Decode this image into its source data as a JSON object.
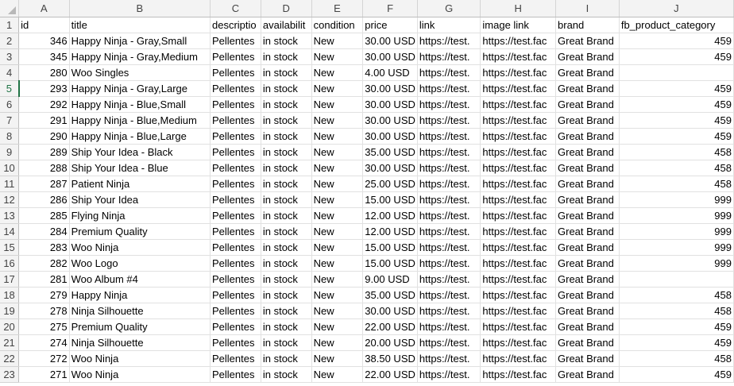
{
  "columns": [
    "A",
    "B",
    "C",
    "D",
    "E",
    "F",
    "G",
    "H",
    "I",
    "J"
  ],
  "rows": [
    {
      "n": "1",
      "cells": [
        "id",
        "title",
        "descriptio",
        "availabilit",
        "condition",
        "price",
        "link",
        "image link",
        "brand",
        "fb_product_category"
      ]
    },
    {
      "n": "2",
      "cells": [
        "346",
        "Happy Ninja - Gray,Small",
        "Pellentes",
        "in stock",
        "New",
        "30.00 USD",
        "https://test.",
        "https://test.fac",
        "Great Brand",
        "459"
      ]
    },
    {
      "n": "3",
      "cells": [
        "345",
        "Happy Ninja - Gray,Medium",
        "Pellentes",
        "in stock",
        "New",
        "30.00 USD",
        "https://test.",
        "https://test.fac",
        "Great Brand",
        "459"
      ]
    },
    {
      "n": "4",
      "cells": [
        "280",
        "Woo Singles",
        "Pellentes",
        "in stock",
        "New",
        "4.00 USD",
        "https://test.",
        "https://test.fac",
        "Great Brand",
        ""
      ]
    },
    {
      "n": "5",
      "cells": [
        "293",
        "Happy Ninja - Gray,Large",
        "Pellentes",
        "in stock",
        "New",
        "30.00 USD",
        "https://test.",
        "https://test.fac",
        "Great Brand",
        "459"
      ]
    },
    {
      "n": "6",
      "cells": [
        "292",
        "Happy Ninja - Blue,Small",
        "Pellentes",
        "in stock",
        "New",
        "30.00 USD",
        "https://test.",
        "https://test.fac",
        "Great Brand",
        "459"
      ]
    },
    {
      "n": "7",
      "cells": [
        "291",
        "Happy Ninja - Blue,Medium",
        "Pellentes",
        "in stock",
        "New",
        "30.00 USD",
        "https://test.",
        "https://test.fac",
        "Great Brand",
        "459"
      ]
    },
    {
      "n": "8",
      "cells": [
        "290",
        "Happy Ninja - Blue,Large",
        "Pellentes",
        "in stock",
        "New",
        "30.00 USD",
        "https://test.",
        "https://test.fac",
        "Great Brand",
        "459"
      ]
    },
    {
      "n": "9",
      "cells": [
        "289",
        "Ship Your Idea - Black",
        "Pellentes",
        "in stock",
        "New",
        "35.00 USD",
        "https://test.",
        "https://test.fac",
        "Great Brand",
        "458"
      ]
    },
    {
      "n": "10",
      "cells": [
        "288",
        "Ship Your Idea - Blue",
        "Pellentes",
        "in stock",
        "New",
        "30.00 USD",
        "https://test.",
        "https://test.fac",
        "Great Brand",
        "458"
      ]
    },
    {
      "n": "11",
      "cells": [
        "287",
        "Patient Ninja",
        "Pellentes",
        "in stock",
        "New",
        "25.00 USD",
        "https://test.",
        "https://test.fac",
        "Great Brand",
        "458"
      ]
    },
    {
      "n": "12",
      "cells": [
        "286",
        "Ship Your Idea",
        "Pellentes",
        "in stock",
        "New",
        "15.00 USD",
        "https://test.",
        "https://test.fac",
        "Great Brand",
        "999"
      ]
    },
    {
      "n": "13",
      "cells": [
        "285",
        "Flying Ninja",
        "Pellentes",
        "in stock",
        "New",
        "12.00 USD",
        "https://test.",
        "https://test.fac",
        "Great Brand",
        "999"
      ]
    },
    {
      "n": "14",
      "cells": [
        "284",
        "Premium Quality",
        "Pellentes",
        "in stock",
        "New",
        "12.00 USD",
        "https://test.",
        "https://test.fac",
        "Great Brand",
        "999"
      ]
    },
    {
      "n": "15",
      "cells": [
        "283",
        "Woo Ninja",
        "Pellentes",
        "in stock",
        "New",
        "15.00 USD",
        "https://test.",
        "https://test.fac",
        "Great Brand",
        "999"
      ]
    },
    {
      "n": "16",
      "cells": [
        "282",
        "Woo Logo",
        "Pellentes",
        "in stock",
        "New",
        "15.00 USD",
        "https://test.",
        "https://test.fac",
        "Great Brand",
        "999"
      ]
    },
    {
      "n": "17",
      "cells": [
        "281",
        "Woo Album #4",
        "Pellentes",
        "in stock",
        "New",
        "9.00 USD",
        "https://test.",
        "https://test.fac",
        "Great Brand",
        ""
      ]
    },
    {
      "n": "18",
      "cells": [
        "279",
        "Happy Ninja",
        "Pellentes",
        "in stock",
        "New",
        "35.00 USD",
        "https://test.",
        "https://test.fac",
        "Great Brand",
        "458"
      ]
    },
    {
      "n": "19",
      "cells": [
        "278",
        "Ninja Silhouette",
        "Pellentes",
        "in stock",
        "New",
        "30.00 USD",
        "https://test.",
        "https://test.fac",
        "Great Brand",
        "458"
      ]
    },
    {
      "n": "20",
      "cells": [
        "275",
        "Premium Quality",
        "Pellentes",
        "in stock",
        "New",
        "22.00 USD",
        "https://test.",
        "https://test.fac",
        "Great Brand",
        "459"
      ]
    },
    {
      "n": "21",
      "cells": [
        "274",
        "Ninja Silhouette",
        "Pellentes",
        "in stock",
        "New",
        "20.00 USD",
        "https://test.",
        "https://test.fac",
        "Great Brand",
        "459"
      ]
    },
    {
      "n": "22",
      "cells": [
        "272",
        "Woo Ninja",
        "Pellentes",
        "in stock",
        "New",
        "38.50 USD",
        "https://test.",
        "https://test.fac",
        "Great Brand",
        "458"
      ]
    },
    {
      "n": "23",
      "cells": [
        "271",
        "Woo Ninja",
        "Pellentes",
        "in stock",
        "New",
        "22.00 USD",
        "https://test.",
        "https://test.fac",
        "Great Brand",
        "459"
      ]
    }
  ],
  "active_row": "5",
  "numeric_columns": [
    0,
    9
  ],
  "colors": {
    "header_bg": "#f3f3f3",
    "grid": "#e1e1e1",
    "accent": "#217346"
  }
}
